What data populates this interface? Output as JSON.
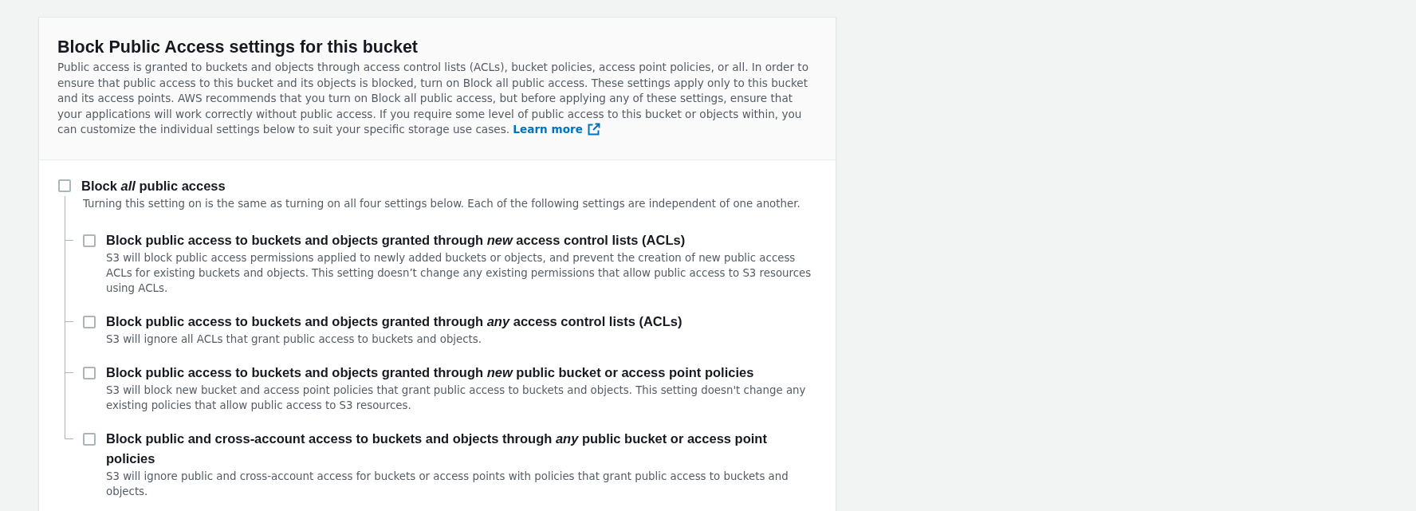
{
  "panel": {
    "title": "Block Public Access settings for this bucket",
    "description": "Public access is granted to buckets and objects through access control lists (ACLs), bucket policies, access point policies, or all. In order to ensure that public access to this bucket and its objects is blocked, turn on Block all public access. These settings apply only to this bucket and its access points. AWS recommends that you turn on Block all public access, but before applying any of these settings, ensure that your applications will work correctly without public access. If you require some level of public access to this bucket or objects within, you can customize the individual settings below to suit your specific storage use cases.",
    "link": {
      "label": "Learn more"
    }
  },
  "block_all": {
    "label": "Block *all* public access",
    "description": "Turning this setting on is the same as turning on all four settings below. Each of the following settings are independent of one another.",
    "checked": false
  },
  "settings": [
    {
      "label": "Block public access to buckets and objects granted through *new* access control lists (ACLs)",
      "description": "S3 will block public access permissions applied to newly added buckets or objects, and prevent the creation of new public access ACLs for existing buckets and objects. This setting doesn’t change any existing permissions that allow public access to S3 resources using ACLs.",
      "checked": false
    },
    {
      "label": "Block public access to buckets and objects granted through *any* access control lists (ACLs)",
      "description": "S3 will ignore all ACLs that grant public access to buckets and objects.",
      "checked": false
    },
    {
      "label": "Block public access to buckets and objects granted through *new* public bucket or access point policies",
      "description": "S3 will block new bucket and access point policies that grant public access to buckets and objects. This setting doesn't change any existing policies that allow public access to S3 resources.",
      "checked": false
    },
    {
      "label": "Block public and cross-account access to buckets and objects through *any* public bucket or access point policies",
      "description": "S3 will ignore public and cross-account access for buckets or access points with policies that grant public access to buckets and objects.",
      "checked": false
    }
  ]
}
